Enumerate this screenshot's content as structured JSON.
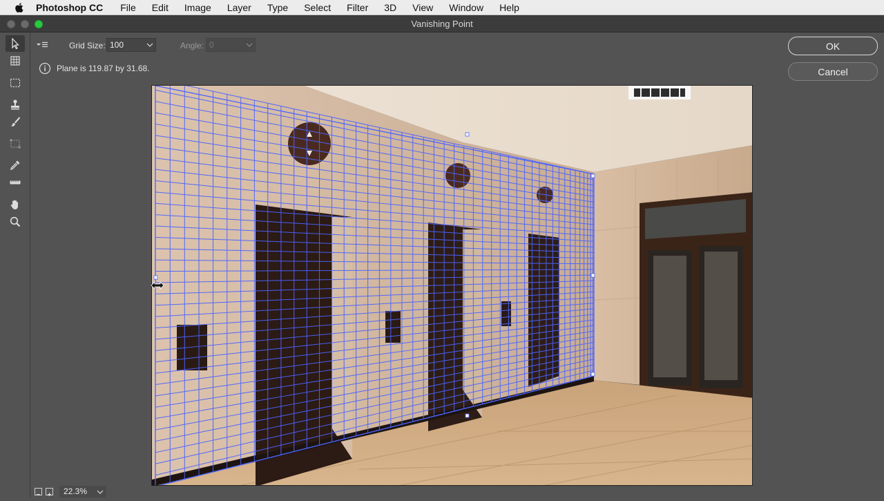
{
  "menubar": {
    "app_name": "Photoshop CC",
    "items": [
      "File",
      "Edit",
      "Image",
      "Layer",
      "Type",
      "Select",
      "Filter",
      "3D",
      "View",
      "Window",
      "Help"
    ]
  },
  "window": {
    "title": "Vanishing Point"
  },
  "tools": [
    "edit-plane-tool",
    "create-plane-tool",
    "marquee-tool",
    "stamp-tool",
    "brush-tool",
    "transform-tool",
    "eyedropper-tool",
    "measure-tool",
    "hand-tool",
    "zoom-tool"
  ],
  "options": {
    "grid_size_label": "Grid Size:",
    "grid_size_value": "100",
    "angle_label": "Angle:",
    "angle_value": "0"
  },
  "info": {
    "message": "Plane is 119.87 by 31.68."
  },
  "buttons": {
    "ok": "OK",
    "cancel": "Cancel"
  },
  "footer": {
    "zoom": "22.3%"
  },
  "colors": {
    "accent": "#28c940",
    "grid": "#4a63ff",
    "panel": "#535353"
  }
}
